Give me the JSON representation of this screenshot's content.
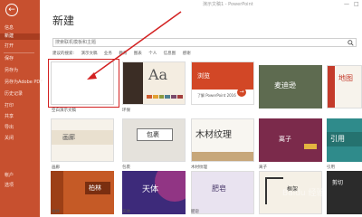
{
  "window": {
    "title": "演示文稿1 - PowerPoint",
    "min": "—",
    "max": "□"
  },
  "sidebar": {
    "back": "←",
    "items": [
      "信息",
      "新建",
      "打开",
      "保存",
      "另存为",
      "另存为Adobe PDF",
      "历史记录",
      "打印",
      "共享",
      "导出",
      "关闭",
      "帐户",
      "选项"
    ]
  },
  "page": {
    "title": "新建"
  },
  "search": {
    "placeholder": "搜索联机模板和主题"
  },
  "suggested": [
    "建议的搜索:",
    "演示文稿",
    "业务",
    "教育",
    "图表",
    "个人",
    "信息图",
    "感谢"
  ],
  "templates": [
    {
      "label": "空白演示文稿"
    },
    {
      "label": "环保",
      "text": "Aa"
    },
    {
      "label": "",
      "text": "浏览",
      "sub": "了解 PowerPoint 2016"
    },
    {
      "label": "",
      "text": "麦迪逊"
    },
    {
      "label": "",
      "text": "地图"
    },
    {
      "label": "画廊",
      "text": "画廊"
    },
    {
      "label": "包裹",
      "text": "包裹"
    },
    {
      "label": "木材纹理",
      "text": "木材纹理"
    },
    {
      "label": "离子",
      "text": "离子"
    },
    {
      "label": "引用",
      "text": "引用"
    },
    {
      "label": "柏林",
      "text": "柏林"
    },
    {
      "label": "天体",
      "text": "天体"
    },
    {
      "label": "肥皂",
      "text": "肥皂"
    },
    {
      "label": "",
      "text": "框架"
    },
    {
      "label": "",
      "text": "剪切"
    }
  ],
  "watermark": "Baidu 经验",
  "colors": {
    "accent": "#c7502f",
    "highlight": "#d32222"
  }
}
